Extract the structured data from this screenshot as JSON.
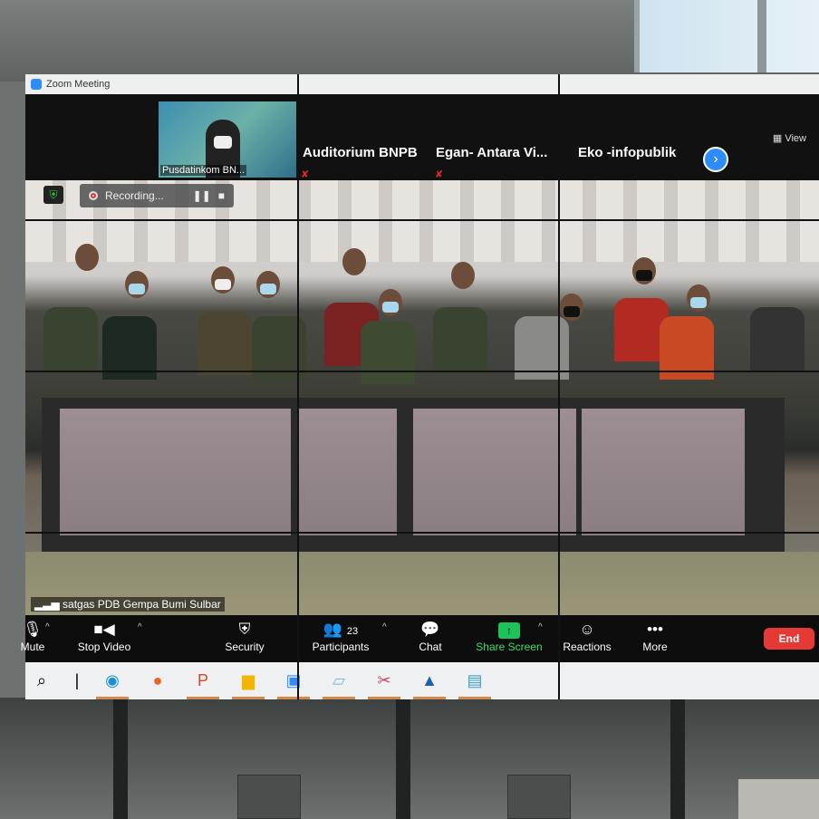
{
  "window": {
    "title": "Zoom Meeting"
  },
  "thumbnails": [
    {
      "name": "Pusdatinkom BN..."
    },
    {
      "name": "Auditorium BNPB",
      "muted": true
    },
    {
      "name": "Egan- Antara Vi...",
      "muted": true
    },
    {
      "name": "Eko -infopublik"
    }
  ],
  "view_label": "View",
  "main_video": {
    "speaker_label": "satgas PDB Gempa Bumi Sulbar",
    "recording_label": "Recording..."
  },
  "toolbar": {
    "mute": "Mute",
    "stop_video": "Stop Video",
    "security": "Security",
    "participants": "Participants",
    "participant_count": "23",
    "chat": "Chat",
    "share_screen": "Share Screen",
    "reactions": "Reactions",
    "more": "More",
    "end": "End"
  },
  "colors": {
    "accent": "#2d8cff",
    "share": "#1ec25a",
    "end": "#e53935"
  },
  "taskbar": {
    "icons": [
      "windows-start-icon",
      "search-icon",
      "edge-icon",
      "firefox-icon",
      "powerpoint-icon",
      "file-explorer-icon",
      "zoom-icon",
      "notepad-icon",
      "snipping-tool-icon",
      "photos-icon",
      "remote-desktop-icon"
    ]
  }
}
